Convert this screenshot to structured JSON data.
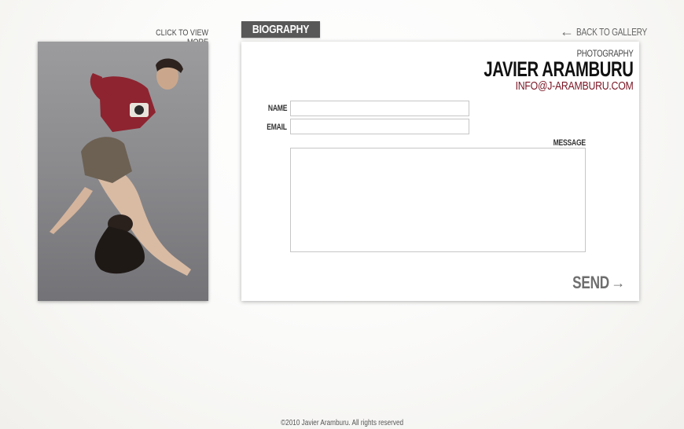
{
  "left": {
    "view_more_label": "CLICK TO VIEW MORE"
  },
  "header": {
    "tab_label": "BIOGRAPHY",
    "back_label": "BACK TO GALLERY"
  },
  "brand": {
    "subtitle": "PHOTOGRAPHY",
    "name": "JAVIER ARAMBURU",
    "email": "INFO@J-ARAMBURU.COM"
  },
  "form": {
    "name_label": "NAME",
    "name_value": "",
    "email_label": "EMAIL",
    "email_value": "",
    "message_label": "MESSAGE",
    "message_value": "",
    "send_label": "SEND"
  },
  "footer": {
    "copyright": "©2010 Javier Aramburu. All rights reserved"
  },
  "colors": {
    "accent": "#7a1524",
    "tab_bg": "#585858"
  },
  "icons": {
    "back": "arrow-left-icon",
    "send": "arrow-right-icon"
  }
}
